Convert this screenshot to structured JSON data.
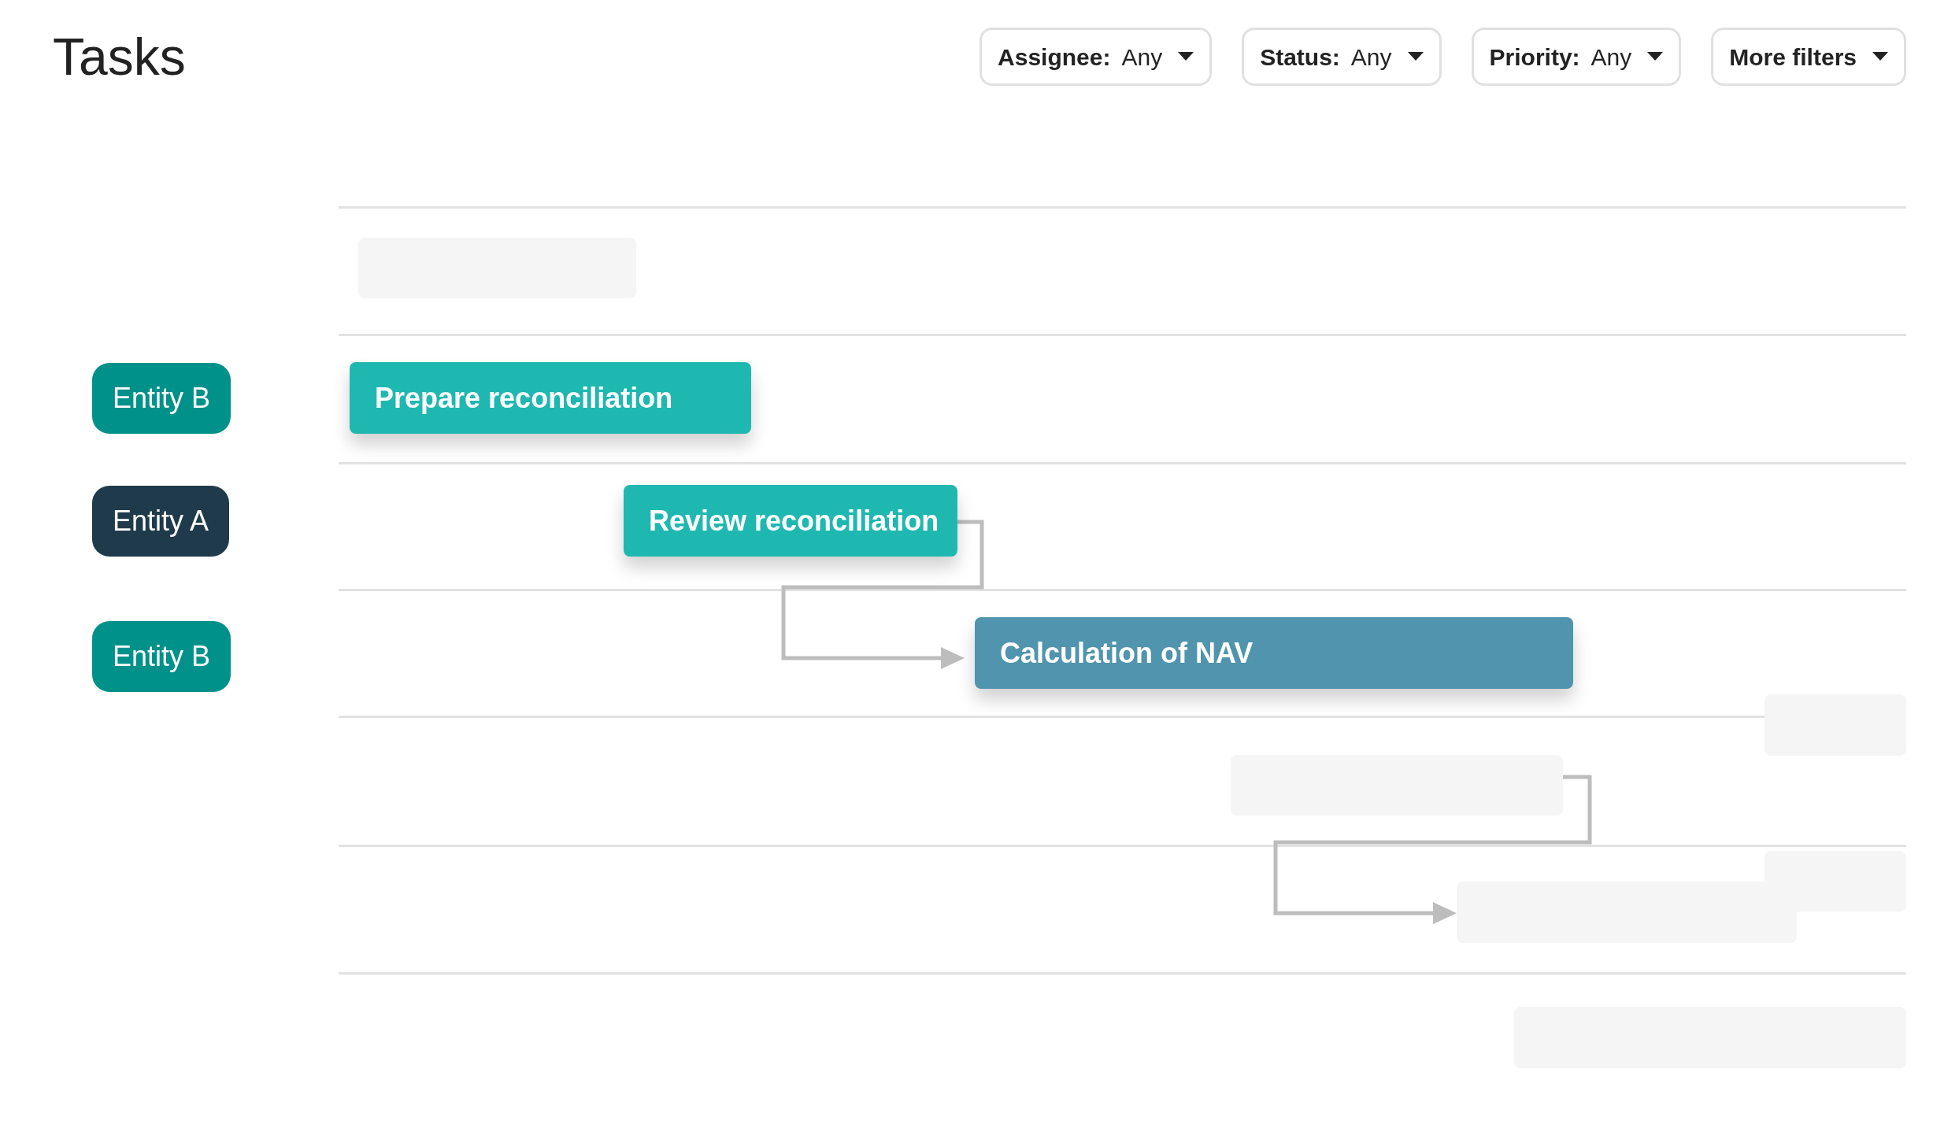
{
  "title": "Tasks",
  "filters": [
    {
      "label": "Assignee:",
      "value": "Any"
    },
    {
      "label": "Status:",
      "value": "Any"
    },
    {
      "label": "Priority:",
      "value": "Any"
    },
    {
      "label": "More filters"
    }
  ],
  "entities": [
    {
      "label": "Entity B",
      "color": "#00918a"
    },
    {
      "label": "Entity A",
      "color": "#1f3a4b"
    },
    {
      "label": "Entity B",
      "color": "#00918a"
    }
  ],
  "tasks": [
    {
      "label": "Prepare reconciliation",
      "color": "#1fb8b1"
    },
    {
      "label": "Review reconciliation",
      "color": "#1fb8b1"
    },
    {
      "label": "Calculation of NAV",
      "color": "#5094ad"
    }
  ]
}
